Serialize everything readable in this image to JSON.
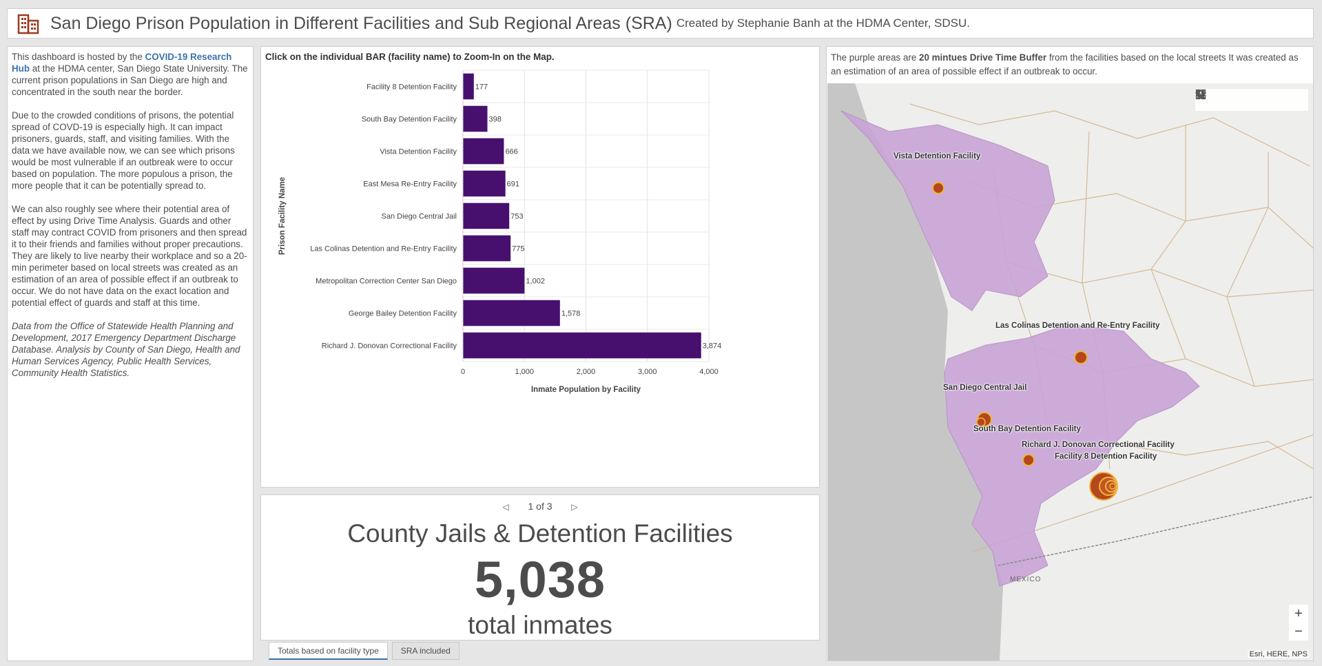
{
  "header": {
    "title": "San Diego Prison Population in Different Facilities and Sub Regional Areas (SRA)",
    "subtitle": "Created by Stephanie Banh at the HDMA Center, SDSU.",
    "logo_icon": "building-icon",
    "accent": "#9c3b1f"
  },
  "left_panel": {
    "p1_pre": "This dashboard is hosted by the ",
    "p1_link": "COVID-19 Research Hub",
    "p1_post": " at the HDMA center, San Diego State University.  The current prison populations in San Diego are high and concentrated in the south near the border.",
    "p2": "Due to the crowded conditions of prisons, the potential spread of COVD-19 is especially high. It can impact prisoners, guards, staff, and visiting families. With the data we have available now, we can see which prisons would be most vulnerable if an outbreak were to occur based on population. The more populous a prison, the more people that it can be potentially spread to.",
    "p3": "We can also roughly see where their potential area of effect by using Drive Time Analysis. Guards and other staff may contract COVID from prisoners and then spread it to their friends and families without proper precautions. They are likely to live nearby their workplace and so a 20-min perimeter based on local streets was created as an estimation of an area of possible effect if an outbreak to occur.  We do not have data on the exact location and potential effect of guards and staff at this time.",
    "p4": "Data from the Office of Statewide Health Planning and Development, 2017 Emergency Department Discharge Database. Analysis by County of San Diego, Health and Human Services Agency, Public Health Services, Community Health Statistics."
  },
  "chart_panel": {
    "hint": "Click on the individual BAR (facility name) to Zoom-In on the Map."
  },
  "chart_data": {
    "type": "bar",
    "orientation": "horizontal",
    "categories": [
      "Facility 8 Detention Facility",
      "South Bay Detention Facility",
      "Vista Detention Facility",
      "East Mesa Re-Entry Facility",
      "San Diego Central Jail",
      "Las Colinas Detention and Re-Entry Facility",
      "Metropolitan Correction Center San Diego",
      "George Bailey Detention Facility",
      "Richard J. Donovan Correctional Facility"
    ],
    "values": [
      177,
      398,
      666,
      691,
      753,
      775,
      1002,
      1578,
      3874
    ],
    "value_labels": [
      "177",
      "398",
      "666",
      "691",
      "753",
      "775",
      "1,002",
      "1,578",
      "3,874"
    ],
    "xlabel": "Inmate Population by Facility",
    "ylabel": "Prison Facility Name",
    "xlim": [
      0,
      4000
    ],
    "ticks": [
      0,
      1000,
      2000,
      3000,
      4000
    ],
    "tick_labels": [
      "0",
      "1,000",
      "2,000",
      "3,000",
      "4,000"
    ],
    "bar_color": "#48106e",
    "grid": true
  },
  "indicator": {
    "pager_text": "1 of 3",
    "top_text": "County Jails & Detention Facilities",
    "value": "5,038",
    "bottom_text": "total inmates"
  },
  "tabs": [
    {
      "label": "Totals based on facility type",
      "active": true
    },
    {
      "label": "SRA included",
      "active": false
    }
  ],
  "map_panel": {
    "desc_pre": "The purple areas are ",
    "desc_bold": "20 mintues Drive Time Buffer",
    "desc_post": " from the facilities based on the local streets  It was created as an estimation of an area of possible effect if an outbreak to occur.",
    "labels": {
      "vista": "Vista Detention Facility",
      "las_colinas": "Las Colinas Detention and Re-Entry Facility",
      "central_jail": "San Diego Central Jail",
      "south_bay": "South Bay Detention Facility",
      "donovan": "Richard J. Donovan Correctional Facility",
      "facility8": "Facility 8 Detention Facility",
      "mexico": "MEXICO"
    },
    "tools": [
      "search-icon",
      "home-icon",
      "legend-icon",
      "layers-icon",
      "basemap-gallery-icon"
    ],
    "zoom_in": "+",
    "zoom_out": "−",
    "attribution": "Esri, HERE, NPS",
    "buffer_color": "#c9a4d6",
    "facility_color": "#b5471c"
  }
}
